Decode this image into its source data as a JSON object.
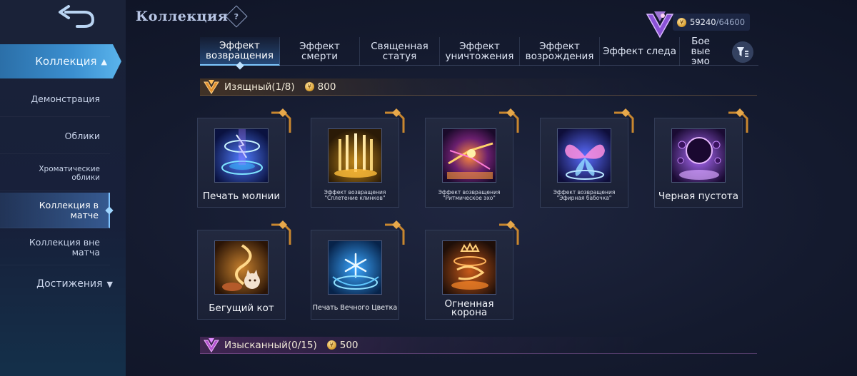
{
  "sidebar": {
    "back_icon": "back-arrow-icon",
    "active_section": "Коллекция",
    "items": [
      {
        "label": "Демонстрация"
      },
      {
        "label": "Облики"
      },
      {
        "label": "Хроматические облики"
      },
      {
        "label": "Коллекция в матче"
      },
      {
        "label": "Коллекция вне матча"
      }
    ],
    "achievements": "Достижения"
  },
  "header": {
    "title": "Коллекция",
    "help_symbol": "?",
    "currency_current": "59240",
    "currency_max": "/64600"
  },
  "tabs": [
    {
      "label": "Эффект возвращения"
    },
    {
      "label": "Эффект смерти"
    },
    {
      "label": "Священная статуя"
    },
    {
      "label": "Эффект уничтожения"
    },
    {
      "label": "Эффект возрождения"
    },
    {
      "label": "Эффект следа"
    },
    {
      "label": "Боевые эмо"
    }
  ],
  "sections": [
    {
      "title": "Изящный(1/8)",
      "price": "800",
      "color": "#d99a3a"
    },
    {
      "title": "Изысканный(0/15)",
      "price": "500",
      "color": "#c46ad6"
    }
  ],
  "cards": [
    {
      "label": "Печать молнии",
      "icon": "lightning-seal-icon"
    },
    {
      "label": "Эффект возвращения \"Сплетение клинков\"",
      "icon": "blades-icon"
    },
    {
      "label": "Эффект возвращения \"Ритмическое эхо\"",
      "icon": "rhythm-echo-icon"
    },
    {
      "label": "Эффект возвращения \"Эфирная бабочка\"",
      "icon": "butterfly-icon"
    },
    {
      "label": "Черная пустота",
      "icon": "black-void-icon"
    },
    {
      "label": "Бегущий кот",
      "icon": "running-cat-icon"
    },
    {
      "label": "Печать Вечного Цветка",
      "icon": "snowflake-seal-icon"
    },
    {
      "label": "Огненная корона",
      "icon": "fire-crown-icon"
    }
  ]
}
